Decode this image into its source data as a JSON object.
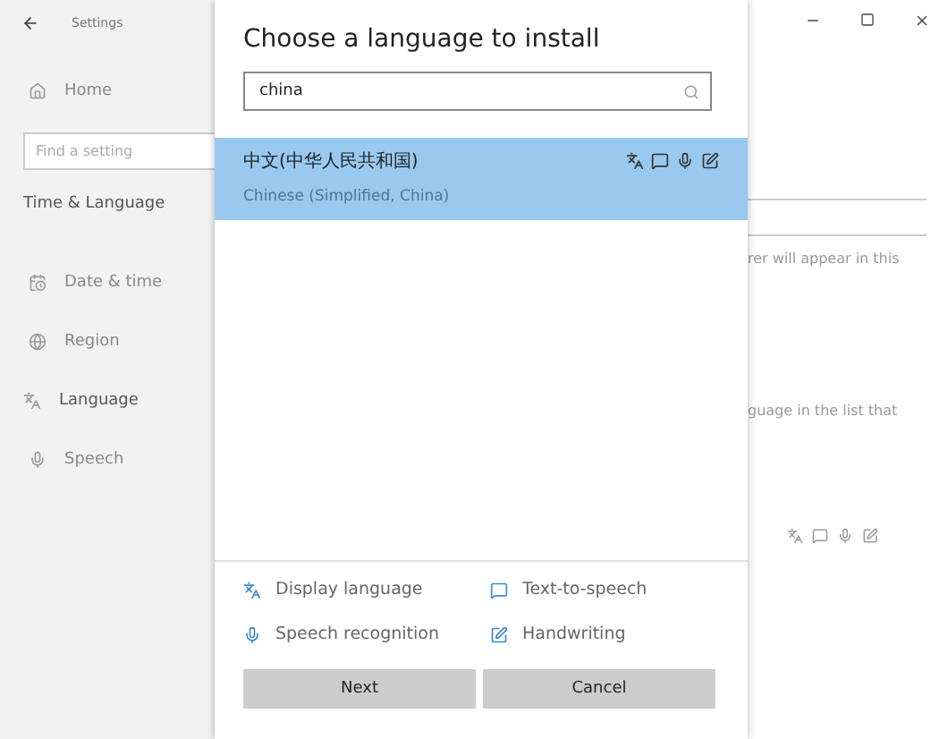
{
  "settings_window": {
    "title": "Settings",
    "home": "Home",
    "search": {
      "placeholder": "Find a setting"
    },
    "section": "Time & Language",
    "nav": [
      {
        "kind": "datetime",
        "label": "Date & time",
        "selected": false
      },
      {
        "kind": "region",
        "label": "Region",
        "selected": false
      },
      {
        "kind": "language",
        "label": "Language",
        "selected": true
      },
      {
        "kind": "speech",
        "label": "Speech",
        "selected": false
      }
    ],
    "background_text": [
      "rer will appear in this",
      "guage in the list that"
    ]
  },
  "dialog": {
    "title": "Choose a language to install",
    "search": {
      "value": "china"
    },
    "results": [
      {
        "name": "中文(中华人民共和国)",
        "subtitle": "Chinese (Simplified, China)",
        "selected": true
      }
    ],
    "features": [
      {
        "kind": "display",
        "label": "Display language"
      },
      {
        "kind": "tts",
        "label": "Text-to-speech"
      },
      {
        "kind": "speech",
        "label": "Speech recognition"
      },
      {
        "kind": "handwriting",
        "label": "Handwriting"
      }
    ],
    "buttons": [
      {
        "label": "Next"
      },
      {
        "label": "Cancel"
      }
    ]
  }
}
